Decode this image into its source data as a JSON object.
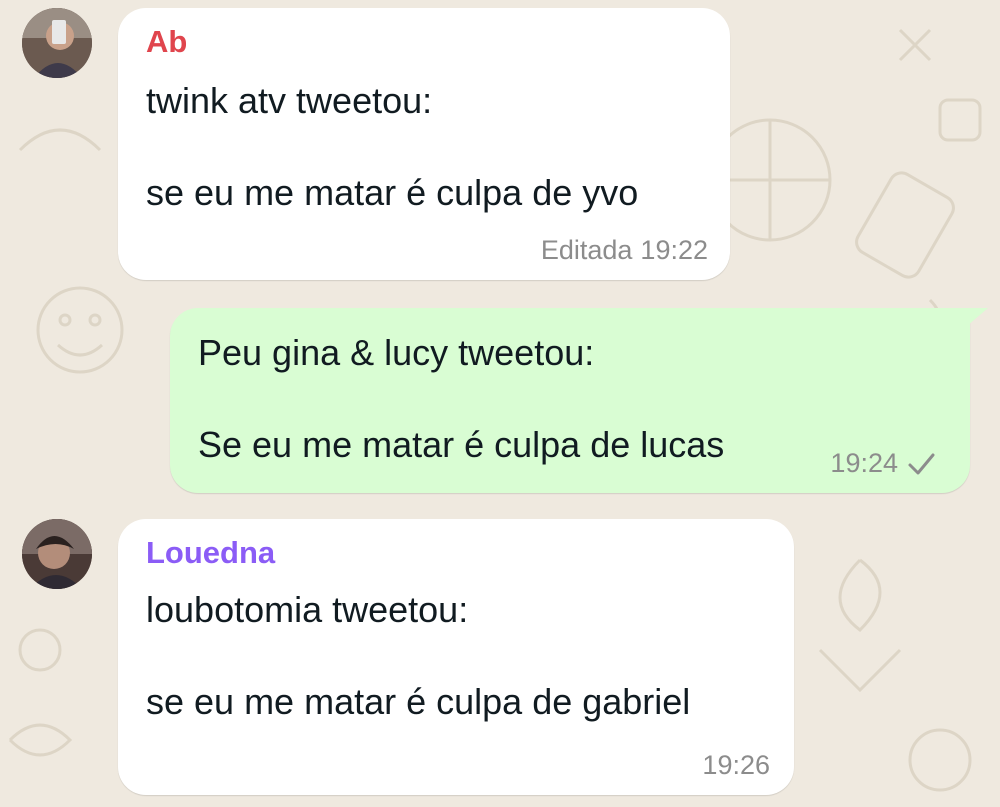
{
  "colors": {
    "wallpaper": "#efe9df",
    "incoming_bubble": "#ffffff",
    "outgoing_bubble": "#d9fdd3",
    "sender_ab": "#e0454d",
    "sender_louedna": "#8b5cf6",
    "timestamp": "#8c8c8c"
  },
  "messages": [
    {
      "direction": "incoming",
      "sender": "Ab",
      "avatar_icon": "profile-photo-avatar",
      "text": "twink atv tweetou:\n\nse eu me matar é culpa de yvo",
      "edited_label": "Editada",
      "time": "19:22"
    },
    {
      "direction": "outgoing",
      "text": "Peu gina & lucy tweetou:\n\nSe eu me matar é culpa de lucas",
      "time": "19:24",
      "status_icon": "single-check-icon"
    },
    {
      "direction": "incoming",
      "sender": "Louedna",
      "avatar_icon": "profile-photo-avatar",
      "text": "loubotomia tweetou:\n\nse eu me matar é culpa de gabriel",
      "time": "19:26"
    }
  ]
}
